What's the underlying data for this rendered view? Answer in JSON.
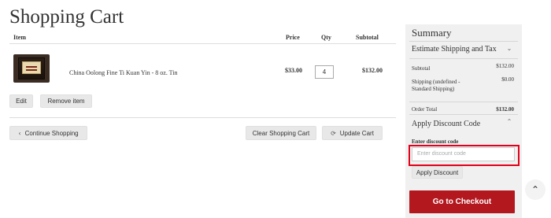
{
  "page": {
    "title": "Shopping Cart"
  },
  "cart": {
    "headers": {
      "item": "Item",
      "price": "Price",
      "qty": "Qty",
      "subtotal": "Subtotal"
    },
    "items": [
      {
        "name": "China Oolong Fine Ti Kuan Yin - 8 oz. Tin",
        "price": "$33.00",
        "qty": "4",
        "subtotal": "$132.00"
      }
    ],
    "edit_label": "Edit",
    "remove_label": "Remove item",
    "continue_label": "Continue Shopping",
    "clear_label": "Clear Shopping Cart",
    "update_label": "Update Cart"
  },
  "summary": {
    "title": "Summary",
    "shipping_section": "Estimate Shipping and Tax",
    "subtotal_label": "Subtotal",
    "subtotal_value": "$132.00",
    "shipping_label": "Shipping (undefined - Standard Shipping)",
    "shipping_value": "$0.00",
    "order_total_label": "Order Total",
    "order_total_value": "$132.00",
    "discount_section": "Apply Discount Code",
    "discount_field_label": "Enter discount code",
    "discount_placeholder": "Enter discount code",
    "apply_label": "Apply Discount",
    "checkout_label": "Go to Checkout"
  },
  "icons": {
    "continue": "chevron-left-icon",
    "update": "refresh-icon",
    "shipping_toggle": "chevron-down-icon",
    "discount_toggle": "chevron-up-icon",
    "scroll_top": "chevron-up-icon"
  },
  "colors": {
    "checkout": "#b3181e",
    "highlight": "#e3001b",
    "summary_bg": "#f0f0f0"
  }
}
